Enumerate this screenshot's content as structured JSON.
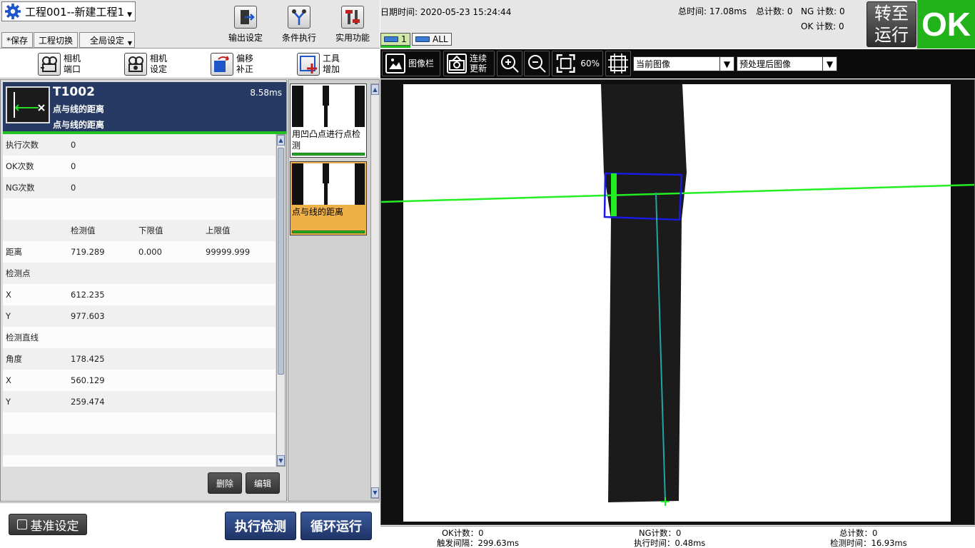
{
  "project": {
    "title": "工程001--新建工程1"
  },
  "menu": {
    "save": "*保存",
    "switch_project": "工程切换",
    "global_settings": "全局设定"
  },
  "toolbar": {
    "output_settings": "输出设定",
    "conditional_exec": "条件执行",
    "utilities": "实用功能"
  },
  "left_tools": [
    {
      "line1": "相机",
      "line2": "端口"
    },
    {
      "line1": "相机",
      "line2": "设定"
    },
    {
      "line1": "偏移",
      "line2": "补正"
    },
    {
      "line1": "工具",
      "line2": "增加"
    }
  ],
  "tool": {
    "id": "T1002",
    "time": "8.58ms",
    "name1": "点与线的距离",
    "name2": "点与线的距离"
  },
  "table": {
    "rows": [
      [
        "执行次数",
        "0",
        "",
        ""
      ],
      [
        "OK次数",
        "0",
        "",
        ""
      ],
      [
        "NG次数",
        "0",
        "",
        ""
      ],
      [
        "",
        "",
        "",
        ""
      ],
      [
        "",
        "检测值",
        "下限值",
        "上限值"
      ],
      [
        "距离",
        "719.289",
        "0.000",
        "99999.999"
      ],
      [
        "检测点",
        "",
        "",
        ""
      ],
      [
        "X",
        "612.235",
        "",
        ""
      ],
      [
        "Y",
        "977.603",
        "",
        ""
      ],
      [
        "检测直线",
        "",
        "",
        ""
      ],
      [
        "角度",
        "178.425",
        "",
        ""
      ],
      [
        "X",
        "560.129",
        "",
        ""
      ],
      [
        "Y",
        "259.474",
        "",
        ""
      ],
      [
        "",
        "",
        "",
        ""
      ],
      [
        "",
        "",
        "",
        ""
      ],
      [
        "",
        "",
        "",
        ""
      ]
    ]
  },
  "buttons": {
    "delete": "删除",
    "edit": "编辑",
    "baseline": "基准设定",
    "execute": "执行检测",
    "loop": "循环运行"
  },
  "flow": [
    {
      "label": "用凹凸点进行点检测",
      "selected": false
    },
    {
      "label": "点与线的距离",
      "selected": true
    }
  ],
  "info": {
    "datetime_label": "日期时间:",
    "datetime": "2020-05-23 15:24:44",
    "total_time_label": "总时间:",
    "total_time": "17.08ms",
    "total_count_label": "总计数:",
    "total_count": "0",
    "ng_count_label": "NG 计数:",
    "ng_count": "0",
    "ok_count_label": "OK 计数:",
    "ok_count": "0"
  },
  "camera_tabs": [
    "1",
    "ALL"
  ],
  "switch_run": {
    "line1": "转至",
    "line2": "运行"
  },
  "result": "OK",
  "image_toolbar": {
    "image_bar": "图像栏",
    "continuous_line1": "连续",
    "continuous_line2": "更新",
    "zoom": "60%",
    "combo1": "当前图像",
    "combo2": "预处理后图像"
  },
  "status": {
    "ok_count": "OK计数：0",
    "trigger_interval": "触发间隔：299.63ms",
    "ng_count": "NG计数：0",
    "exec_time": "执行时间：0.48ms",
    "total_count": "总计数：0",
    "detect_time": "检测时间：16.93ms"
  },
  "colors": {
    "accent_blue": "#263a63",
    "ok_green": "#22b31b",
    "line_green": "#22ee22",
    "roi_blue": "#1a1ae0",
    "perp_cyan": "#21a6a6"
  }
}
